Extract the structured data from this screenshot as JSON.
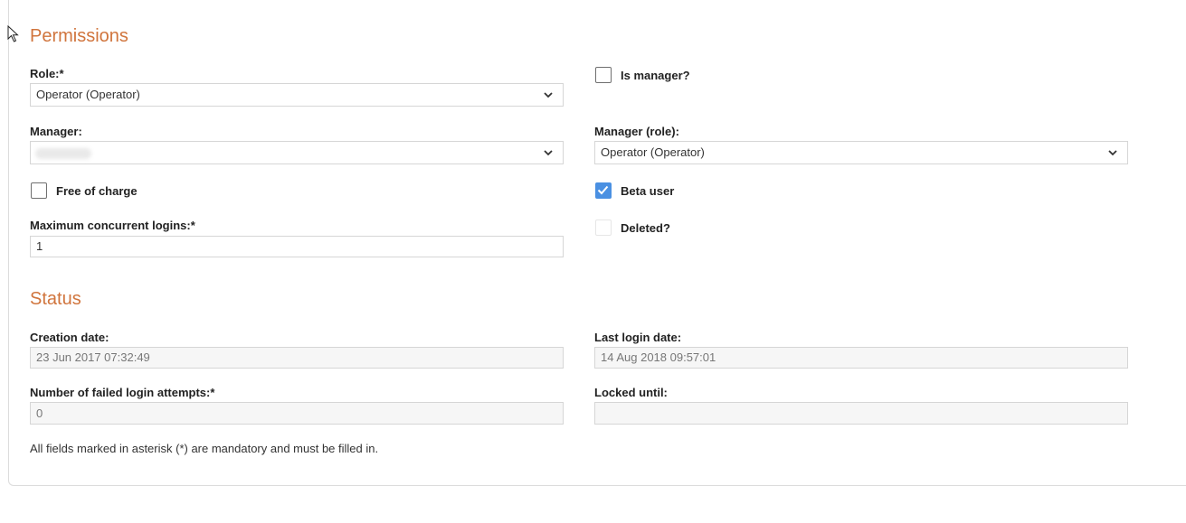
{
  "permissions": {
    "title": "Permissions",
    "role": {
      "label": "Role:*",
      "value": "Operator (Operator)"
    },
    "is_manager": {
      "label": "Is manager?",
      "checked": false
    },
    "manager": {
      "label": "Manager:",
      "value": ""
    },
    "manager_role": {
      "label": "Manager (role):",
      "value": "Operator (Operator)"
    },
    "free_of_charge": {
      "label": "Free of charge",
      "checked": false
    },
    "beta_user": {
      "label": "Beta user",
      "checked": true
    },
    "max_logins": {
      "label": "Maximum concurrent logins:*",
      "value": "1"
    },
    "deleted": {
      "label": "Deleted?",
      "checked": false
    }
  },
  "status": {
    "title": "Status",
    "creation_date": {
      "label": "Creation date:",
      "value": "23 Jun 2017 07:32:49"
    },
    "last_login_date": {
      "label": "Last login date:",
      "value": "14 Aug 2018 09:57:01"
    },
    "failed_attempts": {
      "label": "Number of failed login attempts:*",
      "value": "0"
    },
    "locked_until": {
      "label": "Locked until:",
      "value": ""
    }
  },
  "footer_note": "All fields marked in asterisk (*) are mandatory and must be filled in.",
  "colors": {
    "accent": "#d0743c",
    "checkbox_checked": "#4a90e2"
  },
  "icons": {
    "cursor": "mouse-cursor-icon",
    "dropdown": "chevron-down-icon",
    "check": "checkmark-icon"
  }
}
